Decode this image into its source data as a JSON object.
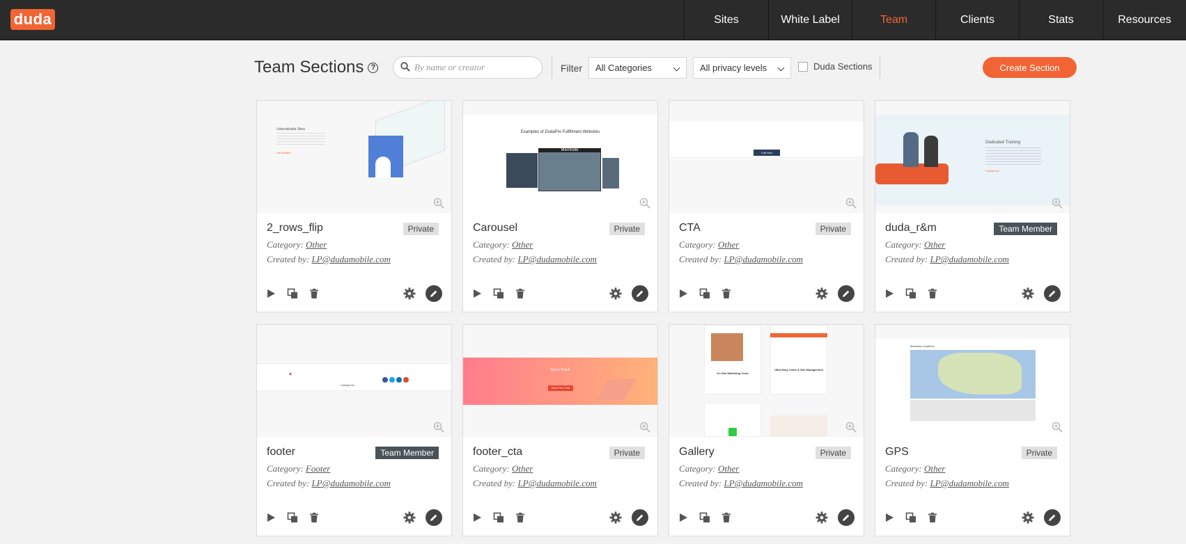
{
  "app": {
    "logo_text": "duda"
  },
  "nav": [
    {
      "label": "Sites",
      "active": false
    },
    {
      "label": "White Label",
      "active": false
    },
    {
      "label": "Team",
      "active": true
    },
    {
      "label": "Clients",
      "active": false
    },
    {
      "label": "Stats",
      "active": false
    },
    {
      "label": "Resources",
      "active": false
    }
  ],
  "toolbar": {
    "title": "Team Sections",
    "help_glyph": "?",
    "search_placeholder": "By name or creator",
    "filter_label": "Filter",
    "category_select": "All Categories",
    "privacy_select": "All privacy levels",
    "duda_sections_label": "Duda Sections",
    "create_label": "Create Section"
  },
  "labels": {
    "category": "Category:",
    "created_by": "Created by:"
  },
  "colors": {
    "accent": "#f26434",
    "nav_bg": "#2b2b2b",
    "team_badge": "#4a5357"
  },
  "cards": [
    {
      "title": "2_rows_flip",
      "badge": "Private",
      "category": "Other",
      "creator": "LP@dudamobile.com",
      "preview_text": "Unbreakable Sites",
      "preview_link": "Get Started"
    },
    {
      "title": "Carousel",
      "badge": "Private",
      "category": "Other",
      "creator": "LP@dudamobile.com",
      "preview_text": "Examples of DudaPro Fulfillment Websites",
      "preview_link": "Merrindie"
    },
    {
      "title": "CTA",
      "badge": "Private",
      "category": "Other",
      "creator": "LP@dudamobile.com",
      "preview_text": "Call Now",
      "preview_link": ""
    },
    {
      "title": "duda_r&m",
      "badge": "Team Member",
      "category": "Other",
      "creator": "LP@dudamobile.com",
      "preview_text": "Dedicated Training",
      "preview_link": "Contact Us"
    },
    {
      "title": "footer",
      "badge": "Team Member",
      "category": "Footer",
      "creator": "LP@dudamobile.com",
      "preview_text": "Contact Us",
      "preview_link": ""
    },
    {
      "title": "footer_cta",
      "badge": "Private",
      "category": "Other",
      "creator": "LP@dudamobile.com",
      "preview_text": "Get in Touch",
      "preview_link": "Start Free Trial"
    },
    {
      "title": "Gallery",
      "badge": "Private",
      "category": "Other",
      "creator": "LP@dudamobile.com",
      "preview_text": "On Site Marketing Tools",
      "preview_link": "Ultra Easy Client & Site Management"
    },
    {
      "title": "GPS",
      "badge": "Private",
      "category": "Other",
      "creator": "LP@dudamobile.com",
      "preview_text": "Business Locations",
      "preview_link": ""
    }
  ]
}
